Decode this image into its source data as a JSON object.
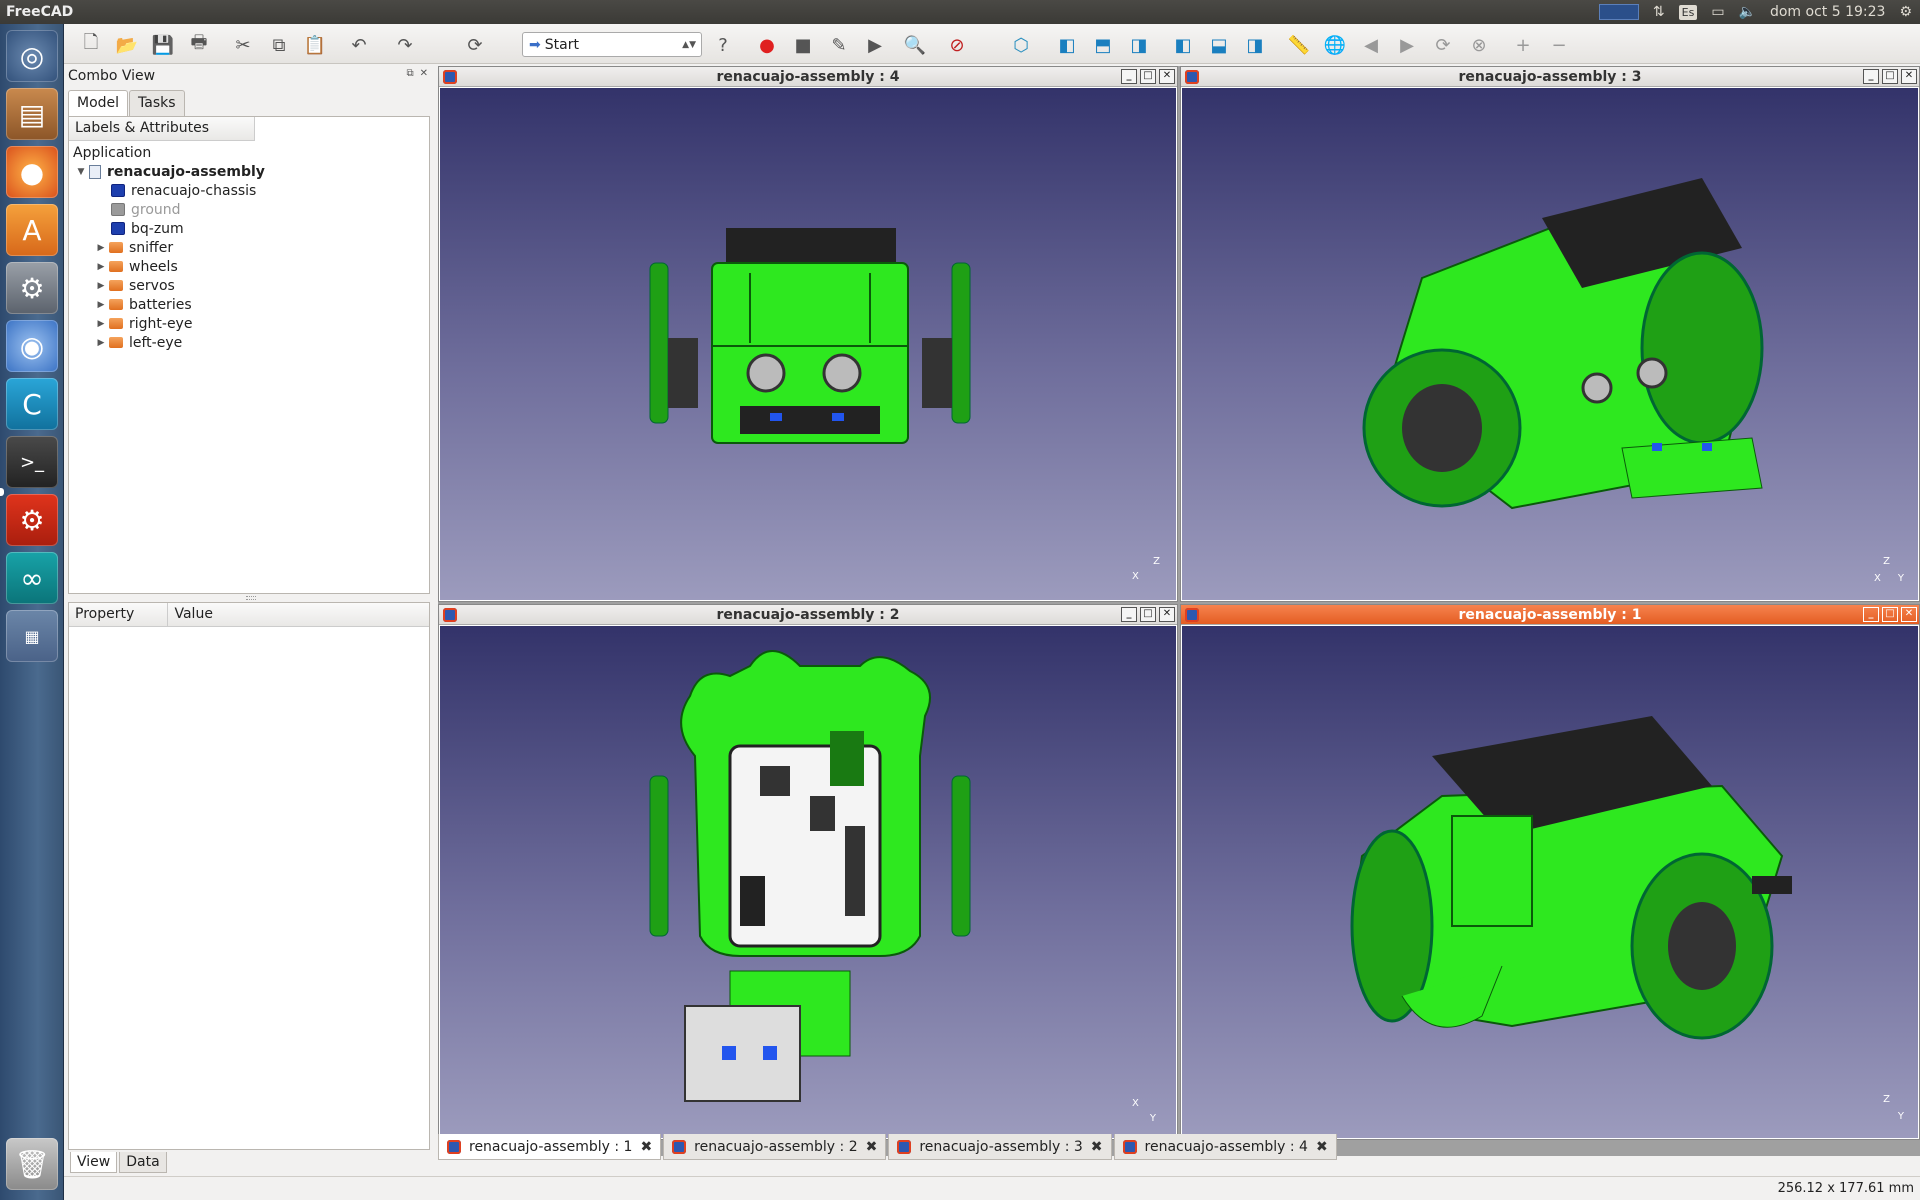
{
  "system": {
    "app_title": "FreeCAD",
    "keyboard": "Es",
    "clock": "dom oct  5 19:23"
  },
  "toolbar": {
    "workbench": "Start"
  },
  "combo": {
    "title": "Combo View",
    "tabs": [
      "Model",
      "Tasks"
    ],
    "tree_header": "Labels & Attributes",
    "tree_root": "Application",
    "document": "renacuajo-assembly",
    "items": [
      {
        "label": "renacuajo-chassis",
        "type": "part"
      },
      {
        "label": "ground",
        "type": "part-hidden"
      },
      {
        "label": "bq-zum",
        "type": "part"
      },
      {
        "label": "sniffer",
        "type": "folder"
      },
      {
        "label": "wheels",
        "type": "folder"
      },
      {
        "label": "servos",
        "type": "folder"
      },
      {
        "label": "batteries",
        "type": "folder"
      },
      {
        "label": "right-eye",
        "type": "folder"
      },
      {
        "label": "left-eye",
        "type": "folder"
      }
    ],
    "prop_headers": [
      "Property",
      "Value"
    ],
    "bottom_tabs": [
      "View",
      "Data"
    ]
  },
  "views": [
    {
      "title": "renacuajo-assembly : 4",
      "active": false
    },
    {
      "title": "renacuajo-assembly : 3",
      "active": false
    },
    {
      "title": "renacuajo-assembly : 2",
      "active": false
    },
    {
      "title": "renacuajo-assembly : 1",
      "active": true
    }
  ],
  "doc_tabs": [
    "renacuajo-assembly : 1",
    "renacuajo-assembly : 2",
    "renacuajo-assembly : 3",
    "renacuajo-assembly : 4"
  ],
  "status": {
    "dimensions": "256.12 x 177.61 mm"
  },
  "axes": {
    "x": "X",
    "y": "Y",
    "z": "Z"
  },
  "colors": {
    "model_green": "#2ee81f",
    "active_title": "#e35d23",
    "viewport_top": "#33336a",
    "viewport_bottom": "#9c9bbd"
  }
}
